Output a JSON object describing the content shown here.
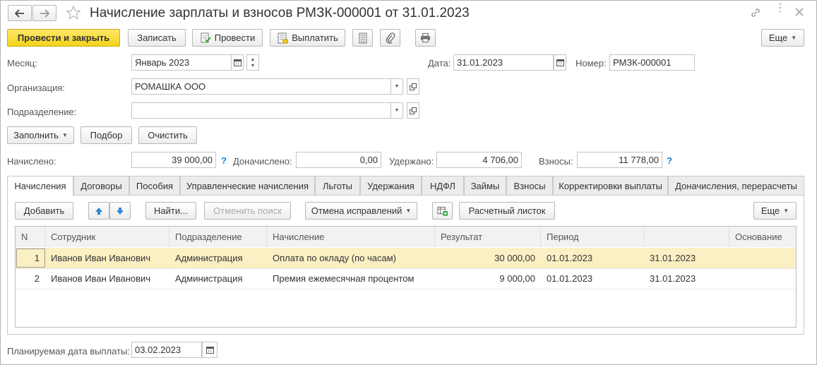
{
  "title": "Начисление зарплаты и взносов РМЗК-000001 от 31.01.2023",
  "toolbar": {
    "post_close": "Провести и закрыть",
    "save": "Записать",
    "post": "Провести",
    "pay": "Выплатить",
    "more": "Еще"
  },
  "form": {
    "month_label": "Месяц:",
    "month_value": "Январь 2023",
    "date_label": "Дата:",
    "date_value": "31.01.2023",
    "number_label": "Номер:",
    "number_value": "РМЗК-000001",
    "org_label": "Организация:",
    "org_value": "РОМАШКА ООО",
    "dept_label": "Подразделение:",
    "dept_value": "",
    "fill_button": "Заполнить",
    "pick_button": "Подбор",
    "clear_button": "Очистить"
  },
  "totals": {
    "accrued_label": "Начислено:",
    "accrued_value": "39 000,00",
    "extra_label": "Доначислено:",
    "extra_value": "0,00",
    "withheld_label": "Удержано:",
    "withheld_value": "4 706,00",
    "contrib_label": "Взносы:",
    "contrib_value": "11 778,00",
    "help": "?"
  },
  "tabs": [
    "Начисления",
    "Договоры",
    "Пособия",
    "Управленческие начисления",
    "Льготы",
    "Удержания",
    "НДФЛ",
    "Займы",
    "Взносы",
    "Корректировки выплаты",
    "Доначисления, перерасчеты"
  ],
  "table_toolbar": {
    "add": "Добавить",
    "find": "Найти...",
    "cancel_search": "Отменить поиск",
    "cancel_fix": "Отмена исправлений",
    "payslip": "Расчетный листок",
    "more": "Еще"
  },
  "table": {
    "columns": [
      "N",
      "Сотрудник",
      "Подразделение",
      "Начисление",
      "Результат",
      "Период",
      "",
      "Основание"
    ],
    "rows": [
      [
        "1",
        "Иванов Иван Иванович",
        "Администрация",
        "Оплата по окладу (по часам)",
        "30 000,00",
        "01.01.2023",
        "31.01.2023",
        ""
      ],
      [
        "2",
        "Иванов Иван Иванович",
        "Администрация",
        "Премия ежемесячная процентом",
        "9 000,00",
        "01.01.2023",
        "31.01.2023",
        ""
      ]
    ]
  },
  "footer": {
    "pay_date_label": "Планируемая дата выплаты:",
    "pay_date_value": "03.02.2023"
  },
  "colors": {
    "primary_button": "#f3d318",
    "selected_row": "#fbf0c4",
    "help_accent": "#1f7fc4",
    "arrow_buttons": "#2f86d6"
  }
}
